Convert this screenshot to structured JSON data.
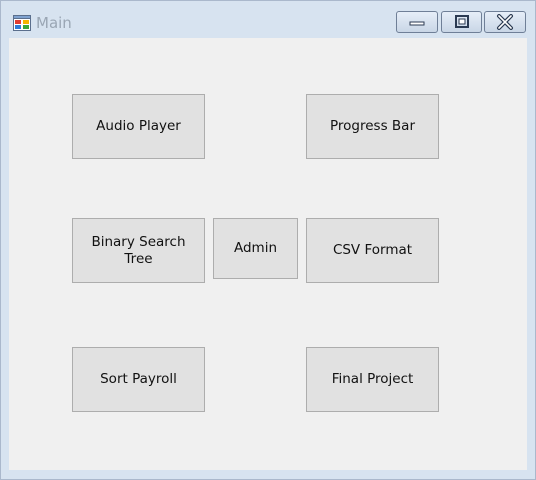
{
  "window": {
    "title": "Main"
  },
  "buttons": {
    "audio_player": "Audio Player",
    "progress_bar": "Progress Bar",
    "binary_search_tree": "Binary Search Tree",
    "admin": "Admin",
    "csv_format": "CSV Format",
    "sort_payroll": "Sort Payroll",
    "final_project": "Final Project"
  },
  "icons": {
    "app": "form-icon",
    "minimize": "minimize-icon",
    "maximize": "maximize-icon",
    "close": "close-icon"
  },
  "colors": {
    "titlebar": "#d7e3f0",
    "client": "#f0f0f0",
    "button_face": "#e1e1e1",
    "button_border": "#adadad"
  }
}
